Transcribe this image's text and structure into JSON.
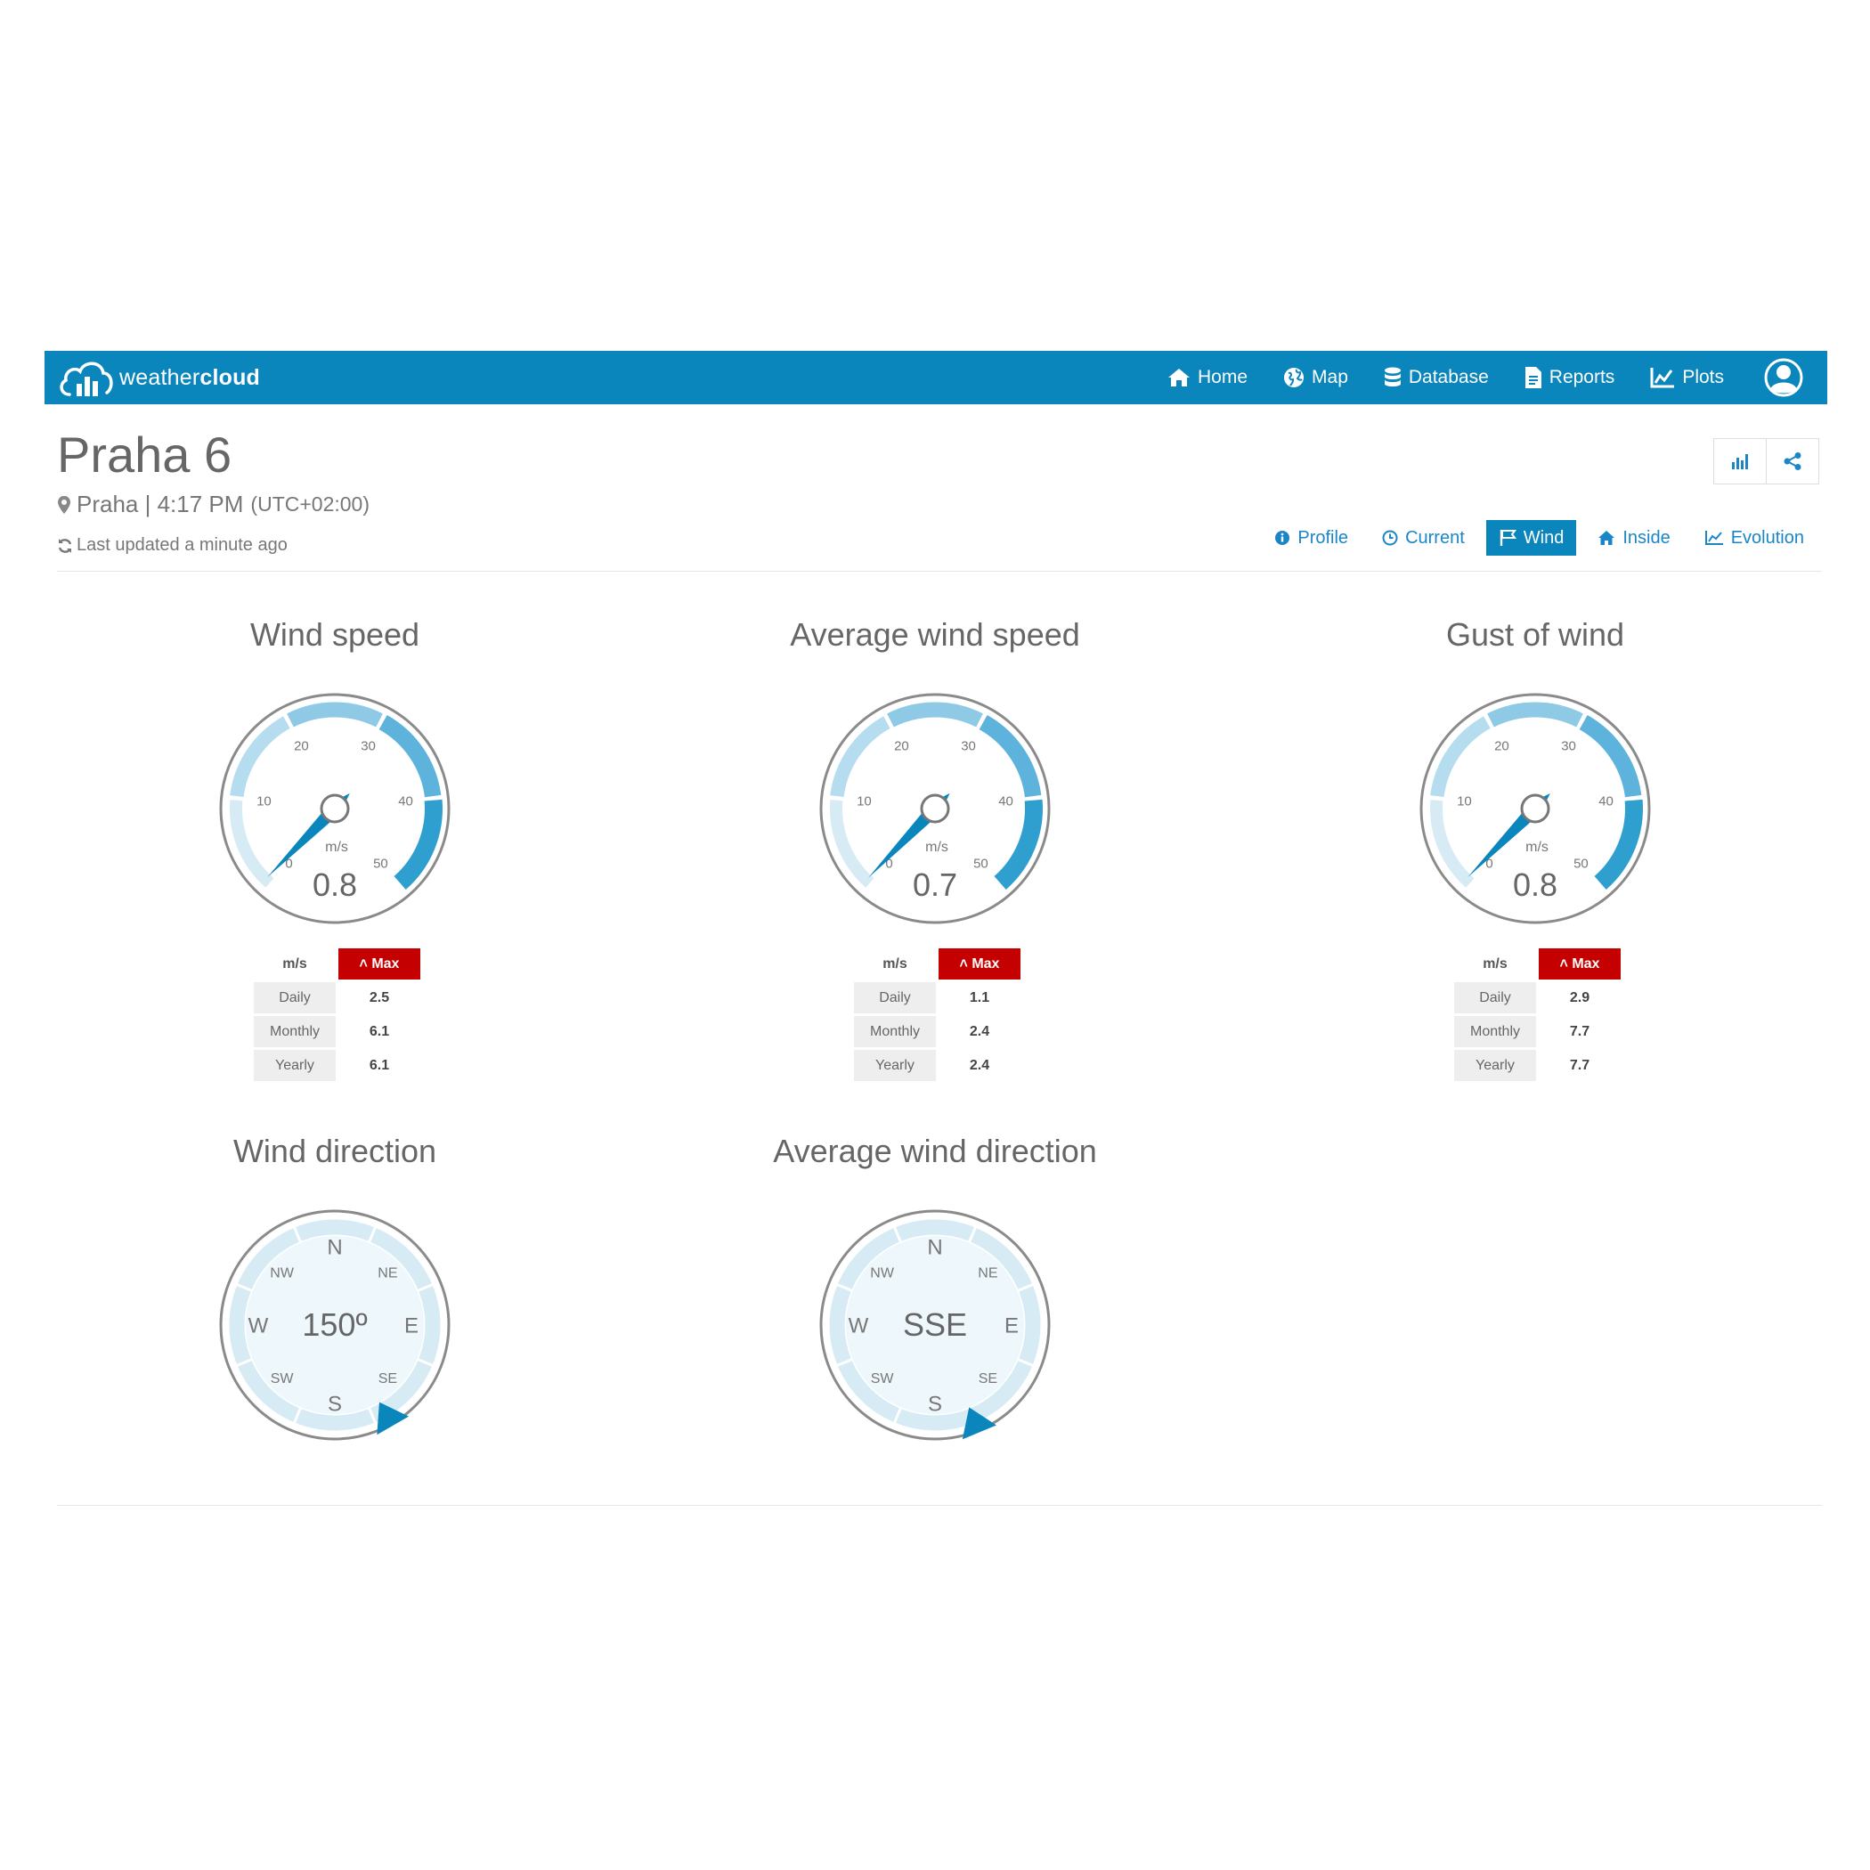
{
  "brand": {
    "name_light": "weather",
    "name_bold": "cloud"
  },
  "nav": {
    "items": [
      {
        "label": "Home",
        "icon": "home-icon"
      },
      {
        "label": "Map",
        "icon": "globe-icon"
      },
      {
        "label": "Database",
        "icon": "database-icon"
      },
      {
        "label": "Reports",
        "icon": "file-icon"
      },
      {
        "label": "Plots",
        "icon": "line-chart-icon"
      }
    ],
    "user_icon": "user-icon"
  },
  "station": {
    "name": "Praha 6",
    "city": "Praha",
    "time": "4:17 PM",
    "timezone": "(UTC+02:00)",
    "updated": "Last updated a minute ago"
  },
  "tabs": [
    {
      "label": "Profile",
      "icon": "info-icon"
    },
    {
      "label": "Current",
      "icon": "clock-icon"
    },
    {
      "label": "Wind",
      "icon": "flag-icon",
      "active": true
    },
    {
      "label": "Inside",
      "icon": "home-icon"
    },
    {
      "label": "Evolution",
      "icon": "line-chart-icon"
    }
  ],
  "colors": {
    "brand": "#0a86bd",
    "max_badge": "#c40000",
    "gauge_light": "#d7ebf5",
    "gauge_dark": "#2f9fd0"
  },
  "speed_gauges": [
    {
      "title": "Wind speed",
      "value": "0.8",
      "unit": "m/s",
      "ticks": [
        "0",
        "10",
        "20",
        "30",
        "40",
        "50"
      ],
      "stats": {
        "unit": "m/s",
        "max_label": "Max",
        "rows": [
          {
            "label": "Daily",
            "value": "2.5"
          },
          {
            "label": "Monthly",
            "value": "6.1"
          },
          {
            "label": "Yearly",
            "value": "6.1"
          }
        ]
      }
    },
    {
      "title": "Average wind speed",
      "value": "0.7",
      "unit": "m/s",
      "ticks": [
        "0",
        "10",
        "20",
        "30",
        "40",
        "50"
      ],
      "stats": {
        "unit": "m/s",
        "max_label": "Max",
        "rows": [
          {
            "label": "Daily",
            "value": "1.1"
          },
          {
            "label": "Monthly",
            "value": "2.4"
          },
          {
            "label": "Yearly",
            "value": "2.4"
          }
        ]
      }
    },
    {
      "title": "Gust of wind",
      "value": "0.8",
      "unit": "m/s",
      "ticks": [
        "0",
        "10",
        "20",
        "30",
        "40",
        "50"
      ],
      "stats": {
        "unit": "m/s",
        "max_label": "Max",
        "rows": [
          {
            "label": "Daily",
            "value": "2.9"
          },
          {
            "label": "Monthly",
            "value": "7.7"
          },
          {
            "label": "Yearly",
            "value": "7.7"
          }
        ]
      }
    }
  ],
  "direction_gauges": [
    {
      "title": "Wind direction",
      "display": "150º",
      "degrees": 150,
      "labels": {
        "n": "N",
        "ne": "NE",
        "e": "E",
        "se": "SE",
        "s": "S",
        "sw": "SW",
        "w": "W",
        "nw": "NW"
      }
    },
    {
      "title": "Average wind direction",
      "display": "SSE",
      "degrees": 157.5,
      "labels": {
        "n": "N",
        "ne": "NE",
        "e": "E",
        "se": "SE",
        "s": "S",
        "sw": "SW",
        "w": "W",
        "nw": "NW"
      }
    }
  ]
}
